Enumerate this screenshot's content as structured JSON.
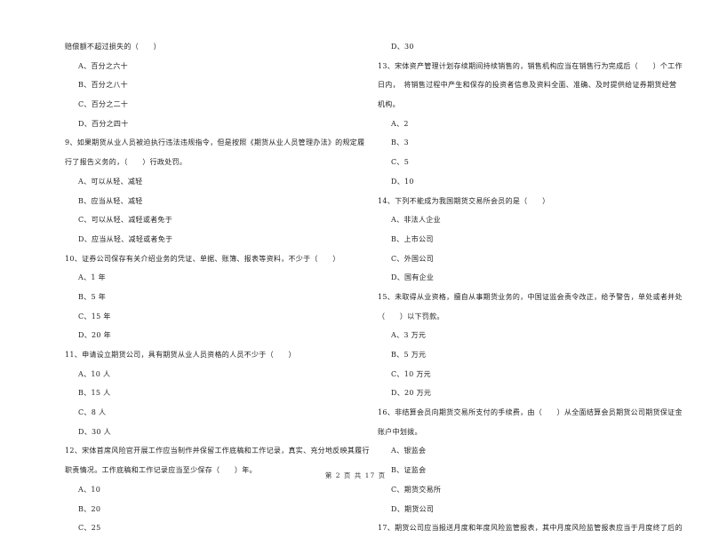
{
  "left_column": [
    {
      "type": "text",
      "text": "赔偿额不超过损失的（　　）"
    },
    {
      "type": "opt",
      "text": "A、百分之六十"
    },
    {
      "type": "opt",
      "text": "B、百分之八十"
    },
    {
      "type": "opt",
      "text": "C、百分之二十"
    },
    {
      "type": "opt",
      "text": "D、百分之四十"
    },
    {
      "type": "text",
      "text": "9、如果期货从业人员被迫执行违法违规指令，但是按照《期货从业人员管理办法》的规定履"
    },
    {
      "type": "text",
      "text": "行了报告义务的，（　　）行政处罚。"
    },
    {
      "type": "opt",
      "text": "A、可以从轻、减轻"
    },
    {
      "type": "opt",
      "text": "B、应当从轻、减轻"
    },
    {
      "type": "opt",
      "text": "C、可以从轻、减轻或者免于"
    },
    {
      "type": "opt",
      "text": "D、应当从轻、减轻或者免于"
    },
    {
      "type": "text",
      "text": "10、证券公司保存有关介绍业务的凭证、单据、账簿、报表等资料，不少于（　　）"
    },
    {
      "type": "opt",
      "text": "A、1 年"
    },
    {
      "type": "opt",
      "text": "B、5 年"
    },
    {
      "type": "opt",
      "text": "C、15 年"
    },
    {
      "type": "opt",
      "text": "D、20 年"
    },
    {
      "type": "text",
      "text": "11、申请设立期货公司，具有期货从业人员资格的人员不少于（　　）"
    },
    {
      "type": "opt",
      "text": "A、10 人"
    },
    {
      "type": "opt",
      "text": "B、15 人"
    },
    {
      "type": "opt",
      "text": "C、8 人"
    },
    {
      "type": "opt",
      "text": "D、30 人"
    },
    {
      "type": "text",
      "text": "12、宋体首席风险官开展工作应当制作并保留工作底稿和工作记录，真实、充分地反映其履行"
    },
    {
      "type": "text",
      "text": "职责情况。工作底稿和工作记录应当至少保存（　　）年。"
    },
    {
      "type": "opt",
      "text": "A、10"
    },
    {
      "type": "opt",
      "text": "B、20"
    },
    {
      "type": "opt",
      "text": "C、25"
    }
  ],
  "right_column": [
    {
      "type": "opt",
      "text": "D、30"
    },
    {
      "type": "text",
      "text": "13、宋体资产管理计划存续期间持续销售的，销售机构应当在销售行为完成后（　　）个工作"
    },
    {
      "type": "text",
      "text": "日内，　将销售过程中产生和保存的投资者信息及资料全面、准确、及时提供给证券期货经营"
    },
    {
      "type": "text",
      "text": "机构。"
    },
    {
      "type": "opt",
      "text": "A、2"
    },
    {
      "type": "opt",
      "text": "B、3"
    },
    {
      "type": "opt",
      "text": "C、5"
    },
    {
      "type": "opt",
      "text": "D、10"
    },
    {
      "type": "text",
      "text": "14、下列不能成为我国期货交易所会员的是（　　）"
    },
    {
      "type": "opt",
      "text": "A、非法人企业"
    },
    {
      "type": "opt",
      "text": "B、上市公司"
    },
    {
      "type": "opt",
      "text": "C、外国公司"
    },
    {
      "type": "opt",
      "text": "D、国有企业"
    },
    {
      "type": "text",
      "text": "15、未取得从业资格，擅自从事期货业务的，中国证监会责令改正，给予警告，单处或者并处"
    },
    {
      "type": "text",
      "text": "（　　）以下罚款。"
    },
    {
      "type": "opt",
      "text": "A、3 万元"
    },
    {
      "type": "opt",
      "text": "B、5 万元"
    },
    {
      "type": "opt",
      "text": "C、10 万元"
    },
    {
      "type": "opt",
      "text": "D、20 万元"
    },
    {
      "type": "text",
      "text": "16、非结算会员向期货交易所支付的手续费，由（　　）从全面结算会员期货公司期货保证金"
    },
    {
      "type": "text",
      "text": "账户中划拨。"
    },
    {
      "type": "opt",
      "text": "A、银监会"
    },
    {
      "type": "opt",
      "text": "B、证监会"
    },
    {
      "type": "opt",
      "text": "C、期货交易所"
    },
    {
      "type": "opt",
      "text": "D、期货公司"
    },
    {
      "type": "text",
      "text": "17、期货公司应当报送月度和年度风险监管报表，其中月度风险监管报表应当于月度终了后的"
    }
  ],
  "footer": {
    "page_indicator": "第 2 页 共 17 页"
  }
}
